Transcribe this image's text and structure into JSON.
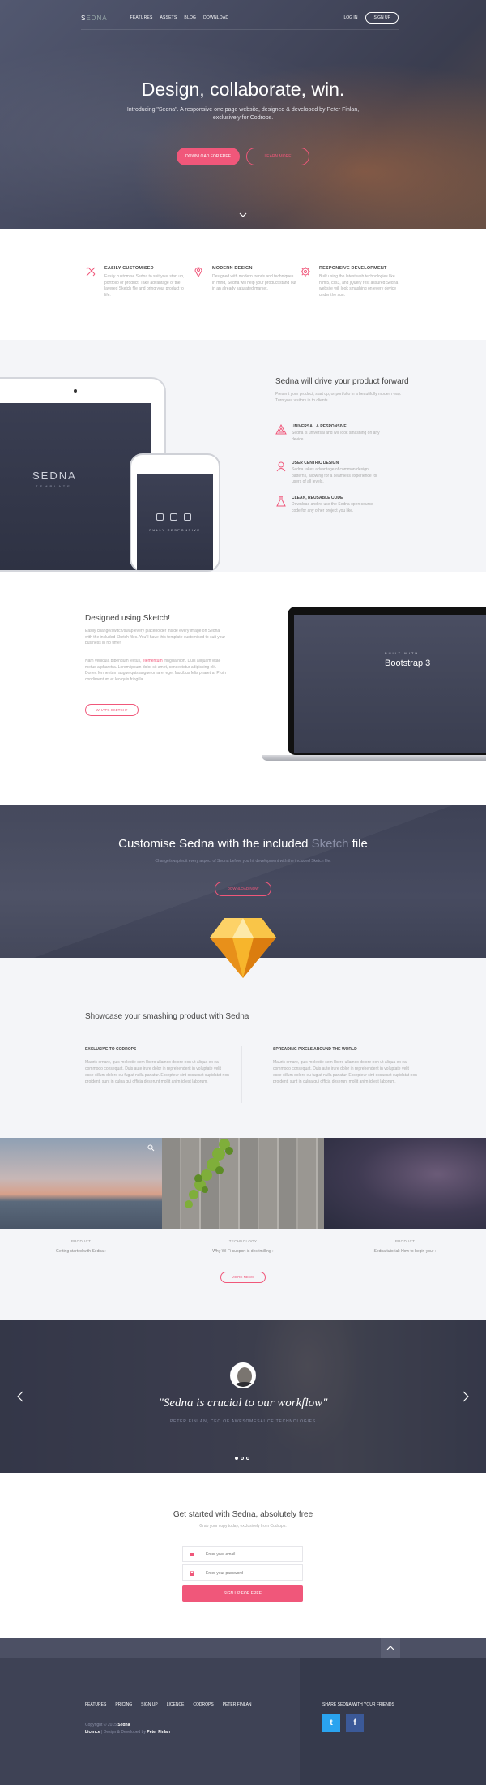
{
  "nav": {
    "logo_a": "S",
    "logo_b": "EDNA",
    "links": [
      "FEATURES",
      "ASSETS",
      "BLOG",
      "DOWNLOAD"
    ],
    "login": "LOG IN",
    "signup": "SIGN UP"
  },
  "hero": {
    "title": "Design, collaborate, win.",
    "subtitle": "Introducing \"Sedna\". A responsive one page website, designed & developed by Peter Finlan, exclusively for Codrops.",
    "btn_download": "DOWNLOAD FOR FREE",
    "btn_learn": "LEARN MORE"
  },
  "features": [
    {
      "title": "EASILY CUSTOMISED",
      "text": "Easily customise Sedna to suit your start up, portfolio or product. Take advantage of the layered Sketch file and bring your product to life."
    },
    {
      "title": "MODERN DESIGN",
      "text": "Designed with modern trends and techniques in mind, Sedna will help your product stand out in an already saturated market."
    },
    {
      "title": "RESPONSIVE DEVELOPMENT",
      "text": "Built using the latest web technologies like html5, css3, and jQuery rest assured Sedna website will look smashing on every device under the sun."
    }
  ],
  "devices": {
    "ipad_logo": "SEDNA",
    "ipad_sub": "TEMPLATE",
    "iphone_caption": "FULLY RESPONSIVE",
    "heading": "Sedna will drive your product forward",
    "text": "Present your product, start up, or portfolio in a beautifully modern way. Turn your visitors in to clients.",
    "items": [
      {
        "title": "UNIVERSAL & RESPONSIVE",
        "text": "Sedna is universal and will look smashing on any device."
      },
      {
        "title": "USER CENTRIC DESIGN",
        "text": "Sedna takes advantage of common design patterns, allowing for a seamless experience for users of all levels."
      },
      {
        "title": "CLEAN, REUSABLE CODE",
        "text": "Download and re-use the Sedna open source code for any other project you like."
      }
    ]
  },
  "sketch": {
    "heading": "Designed using Sketch!",
    "p1": "Easily change/switch/swap every placeholder inside every image on Sedna with the included Sketch files. You'll have this template customised to suit your business in no time!",
    "p2a": "Nam vehicula bibendum lectus, ",
    "p2b": "elementum",
    "p2c": " fringilla nibh. Duis aliquam vitae metus a pharetra. Lorem ipsum dolor sit amet, consectetur adipiscing elit. Donec fermentum augue quis augue ornare, eget faucibus felis pharetra. Proin condimentum et leo quis fringilla.",
    "btn": "WHAT'S SKETCH?",
    "laptop_small": "BUILT WITH",
    "laptop_big": "Bootstrap 3"
  },
  "customise": {
    "h1": "Customise Sedna with the included ",
    "h2": "Sketch",
    "h3": " file",
    "sub": "Change/swap/edit every aspect of Sedna before you hit development with the included Sketch file.",
    "btn": "DOWNLOAD NOW"
  },
  "showcase": {
    "heading": "Showcase your smashing product with Sedna",
    "cols": [
      {
        "title": "EXCLUSIVE TO CODROPS",
        "text": "Mauris ornare, quis molestie sem libero ullamco dolore non ut aliqua ex ea commodo consequat. Duis aute irure dolor in reprehenderit in voluptate velit esse cillum dolore eu fugiat nulla pariatur. Excepteur sint occaecat cupidatat non proident, sunt in culpa qui officia deserunt mollit anim id est laborum."
      },
      {
        "title": "SPREADING PIXELS AROUND THE WORLD",
        "text": "Mauris ornare, quis molestie sem libero ullamco dolore non ut aliqua ex ea commodo consequat. Duis aute irure dolor in reprehenderit in voluptate velit esse cillum dolore eu fugiat nulla pariatur. Excepteur sint occaecat cupidatat non proident, sunt in culpa qui officia deserunt mollit anim id est laborum."
      }
    ]
  },
  "blog": {
    "posts": [
      {
        "cat": "PRODUCT",
        "title": "Getting started with Sedna"
      },
      {
        "cat": "TECHNOLOGY",
        "title": "Why Wi-Fi support is decrimilling"
      },
      {
        "cat": "PRODUCT",
        "title": "Sedna tutorial: How to begin your"
      }
    ],
    "more": "MORE NEWS"
  },
  "testimonial": {
    "quote": "\"Sedna is crucial to our workflow\"",
    "by": "PETER FINLAN, CEO OF AWESOMESAUCE TECHNOLOGIES"
  },
  "signup": {
    "heading": "Get started with Sedna, absolutely free",
    "sub": "Grab your copy today, exclusively from Codrops.",
    "email_ph": "Enter your email",
    "pass_ph": "Enter your password",
    "btn": "SIGN UP FOR FREE"
  },
  "footer": {
    "links": [
      "FEATURES",
      "PRICING",
      "SIGN UP",
      "LICENCE",
      "CODROPS",
      "PETER FINLAN"
    ],
    "copy_a": "Copyright © 2015 ",
    "copy_b": "Sedna",
    "copy_c": "Licence",
    "copy_d": " | Design & Developed by ",
    "copy_e": "Peter Finlan",
    "share": "SHARE SEDNA WITH YOUR FRIENDS",
    "twitter": "t",
    "facebook": "f"
  },
  "colors": {
    "accent": "#f0577a",
    "dark": "#3e4255",
    "light": "#f4f5f8",
    "twitter": "#2aa3ef",
    "facebook": "#3b5998"
  }
}
